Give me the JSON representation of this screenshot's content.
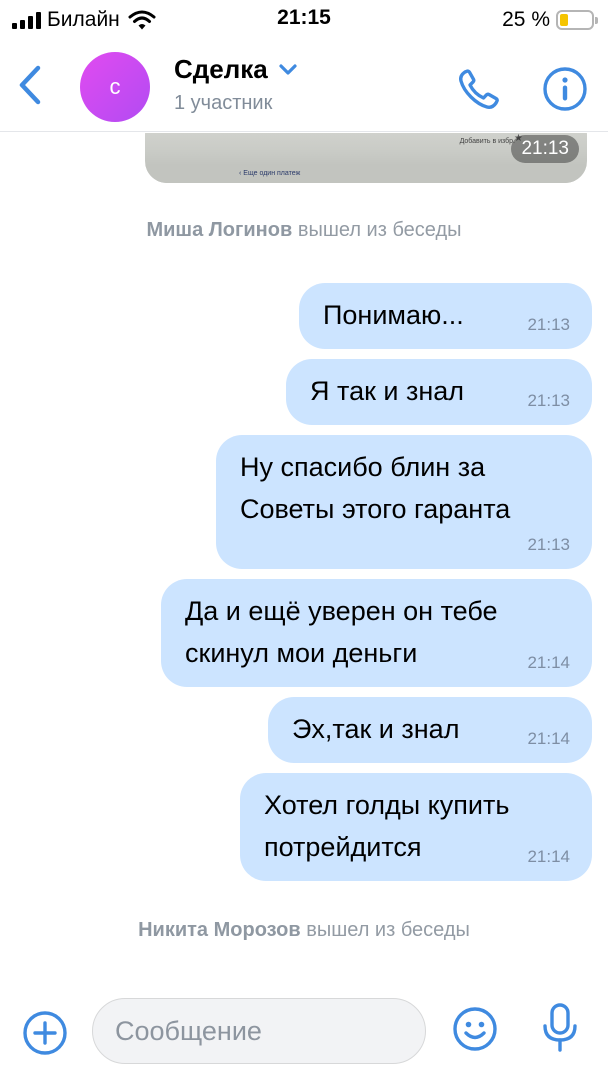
{
  "status_bar": {
    "carrier": "Билайн",
    "time": "21:15",
    "battery_percent": "25 %",
    "battery_level": 0.25,
    "battery_color": "#f5c400"
  },
  "header": {
    "back_icon": "chevron-left-icon",
    "avatar_letter": "с",
    "avatar_color": "#c94bf2",
    "title": "Сделка",
    "title_dropdown_icon": "chevron-down-icon",
    "subtitle": "1 участник",
    "call_icon": "phone-icon",
    "info_icon": "info-icon",
    "accent": "#3f8ae0"
  },
  "chat": {
    "photo_message": {
      "time": "21:13",
      "caption_left": "‹ Еще один платеж",
      "caption_right": "Добавить в избр."
    },
    "system_messages": [
      {
        "name": "Миша Логинов",
        "text": "вышел из беседы"
      },
      {
        "name": "Никита Морозов",
        "text": "вышел из беседы"
      }
    ],
    "messages": [
      {
        "lines": [
          "Понимаю..."
        ],
        "time": "21:13"
      },
      {
        "lines": [
          "Я так и знал"
        ],
        "time": "21:13"
      },
      {
        "lines": [
          "Ну спасибо блин за",
          "Советы этого гаранта"
        ],
        "time": "21:13"
      },
      {
        "lines": [
          "Да и ещё уверен он тебе",
          "скинул мои деньги"
        ],
        "time": "21:14"
      },
      {
        "lines": [
          "Эх,так и знал"
        ],
        "time": "21:14"
      },
      {
        "lines": [
          "Хотел голды купить",
          "потрейдится"
        ],
        "time": "21:14"
      }
    ],
    "bubble_color": "#cce4ff"
  },
  "composer": {
    "add_icon": "plus-circle-icon",
    "placeholder": "Сообщение",
    "value": "",
    "emoji_icon": "smile-icon",
    "mic_icon": "microphone-icon"
  }
}
